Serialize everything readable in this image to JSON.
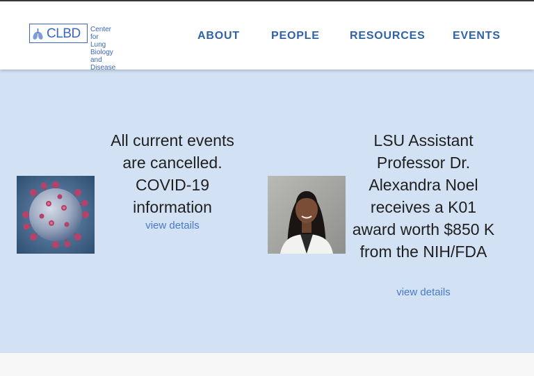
{
  "header": {
    "logo": {
      "abbr": "CLBD",
      "full_name_line1": "Center for Lung",
      "full_name_line2": "Biology and Disease"
    },
    "nav": [
      {
        "label": "ABOUT"
      },
      {
        "label": "PEOPLE"
      },
      {
        "label": "RESOURCES"
      },
      {
        "label": "EVENTS"
      }
    ]
  },
  "events": [
    {
      "title": "All current events are cancelled. COVID-19 information",
      "link_label": "view details",
      "image": "coronavirus-illustration"
    },
    {
      "title": "LSU Assistant Professor Dr. Alexandra Noel receives a K01 award worth $850 K from the NIH/FDA",
      "link_label": "view details",
      "image": "portrait-photo"
    }
  ],
  "colors": {
    "brand_blue": "#3b66c4",
    "nav_blue": "#2f62a6",
    "link_blue": "#4a7ac6",
    "hero_background": "#d2e1f3"
  }
}
